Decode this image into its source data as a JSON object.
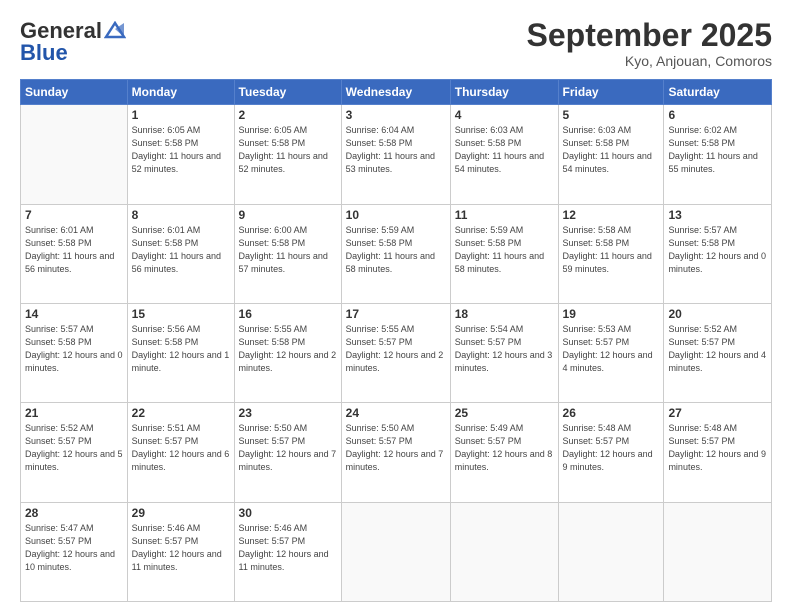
{
  "header": {
    "logo_general": "General",
    "logo_blue": "Blue",
    "month_title": "September 2025",
    "subtitle": "Kyo, Anjouan, Comoros"
  },
  "weekdays": [
    "Sunday",
    "Monday",
    "Tuesday",
    "Wednesday",
    "Thursday",
    "Friday",
    "Saturday"
  ],
  "weeks": [
    [
      {
        "day": "",
        "sunrise": "",
        "sunset": "",
        "daylight": ""
      },
      {
        "day": "1",
        "sunrise": "Sunrise: 6:05 AM",
        "sunset": "Sunset: 5:58 PM",
        "daylight": "Daylight: 11 hours and 52 minutes."
      },
      {
        "day": "2",
        "sunrise": "Sunrise: 6:05 AM",
        "sunset": "Sunset: 5:58 PM",
        "daylight": "Daylight: 11 hours and 52 minutes."
      },
      {
        "day": "3",
        "sunrise": "Sunrise: 6:04 AM",
        "sunset": "Sunset: 5:58 PM",
        "daylight": "Daylight: 11 hours and 53 minutes."
      },
      {
        "day": "4",
        "sunrise": "Sunrise: 6:03 AM",
        "sunset": "Sunset: 5:58 PM",
        "daylight": "Daylight: 11 hours and 54 minutes."
      },
      {
        "day": "5",
        "sunrise": "Sunrise: 6:03 AM",
        "sunset": "Sunset: 5:58 PM",
        "daylight": "Daylight: 11 hours and 54 minutes."
      },
      {
        "day": "6",
        "sunrise": "Sunrise: 6:02 AM",
        "sunset": "Sunset: 5:58 PM",
        "daylight": "Daylight: 11 hours and 55 minutes."
      }
    ],
    [
      {
        "day": "7",
        "sunrise": "Sunrise: 6:01 AM",
        "sunset": "Sunset: 5:58 PM",
        "daylight": "Daylight: 11 hours and 56 minutes."
      },
      {
        "day": "8",
        "sunrise": "Sunrise: 6:01 AM",
        "sunset": "Sunset: 5:58 PM",
        "daylight": "Daylight: 11 hours and 56 minutes."
      },
      {
        "day": "9",
        "sunrise": "Sunrise: 6:00 AM",
        "sunset": "Sunset: 5:58 PM",
        "daylight": "Daylight: 11 hours and 57 minutes."
      },
      {
        "day": "10",
        "sunrise": "Sunrise: 5:59 AM",
        "sunset": "Sunset: 5:58 PM",
        "daylight": "Daylight: 11 hours and 58 minutes."
      },
      {
        "day": "11",
        "sunrise": "Sunrise: 5:59 AM",
        "sunset": "Sunset: 5:58 PM",
        "daylight": "Daylight: 11 hours and 58 minutes."
      },
      {
        "day": "12",
        "sunrise": "Sunrise: 5:58 AM",
        "sunset": "Sunset: 5:58 PM",
        "daylight": "Daylight: 11 hours and 59 minutes."
      },
      {
        "day": "13",
        "sunrise": "Sunrise: 5:57 AM",
        "sunset": "Sunset: 5:58 PM",
        "daylight": "Daylight: 12 hours and 0 minutes."
      }
    ],
    [
      {
        "day": "14",
        "sunrise": "Sunrise: 5:57 AM",
        "sunset": "Sunset: 5:58 PM",
        "daylight": "Daylight: 12 hours and 0 minutes."
      },
      {
        "day": "15",
        "sunrise": "Sunrise: 5:56 AM",
        "sunset": "Sunset: 5:58 PM",
        "daylight": "Daylight: 12 hours and 1 minute."
      },
      {
        "day": "16",
        "sunrise": "Sunrise: 5:55 AM",
        "sunset": "Sunset: 5:58 PM",
        "daylight": "Daylight: 12 hours and 2 minutes."
      },
      {
        "day": "17",
        "sunrise": "Sunrise: 5:55 AM",
        "sunset": "Sunset: 5:57 PM",
        "daylight": "Daylight: 12 hours and 2 minutes."
      },
      {
        "day": "18",
        "sunrise": "Sunrise: 5:54 AM",
        "sunset": "Sunset: 5:57 PM",
        "daylight": "Daylight: 12 hours and 3 minutes."
      },
      {
        "day": "19",
        "sunrise": "Sunrise: 5:53 AM",
        "sunset": "Sunset: 5:57 PM",
        "daylight": "Daylight: 12 hours and 4 minutes."
      },
      {
        "day": "20",
        "sunrise": "Sunrise: 5:52 AM",
        "sunset": "Sunset: 5:57 PM",
        "daylight": "Daylight: 12 hours and 4 minutes."
      }
    ],
    [
      {
        "day": "21",
        "sunrise": "Sunrise: 5:52 AM",
        "sunset": "Sunset: 5:57 PM",
        "daylight": "Daylight: 12 hours and 5 minutes."
      },
      {
        "day": "22",
        "sunrise": "Sunrise: 5:51 AM",
        "sunset": "Sunset: 5:57 PM",
        "daylight": "Daylight: 12 hours and 6 minutes."
      },
      {
        "day": "23",
        "sunrise": "Sunrise: 5:50 AM",
        "sunset": "Sunset: 5:57 PM",
        "daylight": "Daylight: 12 hours and 7 minutes."
      },
      {
        "day": "24",
        "sunrise": "Sunrise: 5:50 AM",
        "sunset": "Sunset: 5:57 PM",
        "daylight": "Daylight: 12 hours and 7 minutes."
      },
      {
        "day": "25",
        "sunrise": "Sunrise: 5:49 AM",
        "sunset": "Sunset: 5:57 PM",
        "daylight": "Daylight: 12 hours and 8 minutes."
      },
      {
        "day": "26",
        "sunrise": "Sunrise: 5:48 AM",
        "sunset": "Sunset: 5:57 PM",
        "daylight": "Daylight: 12 hours and 9 minutes."
      },
      {
        "day": "27",
        "sunrise": "Sunrise: 5:48 AM",
        "sunset": "Sunset: 5:57 PM",
        "daylight": "Daylight: 12 hours and 9 minutes."
      }
    ],
    [
      {
        "day": "28",
        "sunrise": "Sunrise: 5:47 AM",
        "sunset": "Sunset: 5:57 PM",
        "daylight": "Daylight: 12 hours and 10 minutes."
      },
      {
        "day": "29",
        "sunrise": "Sunrise: 5:46 AM",
        "sunset": "Sunset: 5:57 PM",
        "daylight": "Daylight: 12 hours and 11 minutes."
      },
      {
        "day": "30",
        "sunrise": "Sunrise: 5:46 AM",
        "sunset": "Sunset: 5:57 PM",
        "daylight": "Daylight: 12 hours and 11 minutes."
      },
      {
        "day": "",
        "sunrise": "",
        "sunset": "",
        "daylight": ""
      },
      {
        "day": "",
        "sunrise": "",
        "sunset": "",
        "daylight": ""
      },
      {
        "day": "",
        "sunrise": "",
        "sunset": "",
        "daylight": ""
      },
      {
        "day": "",
        "sunrise": "",
        "sunset": "",
        "daylight": ""
      }
    ]
  ]
}
